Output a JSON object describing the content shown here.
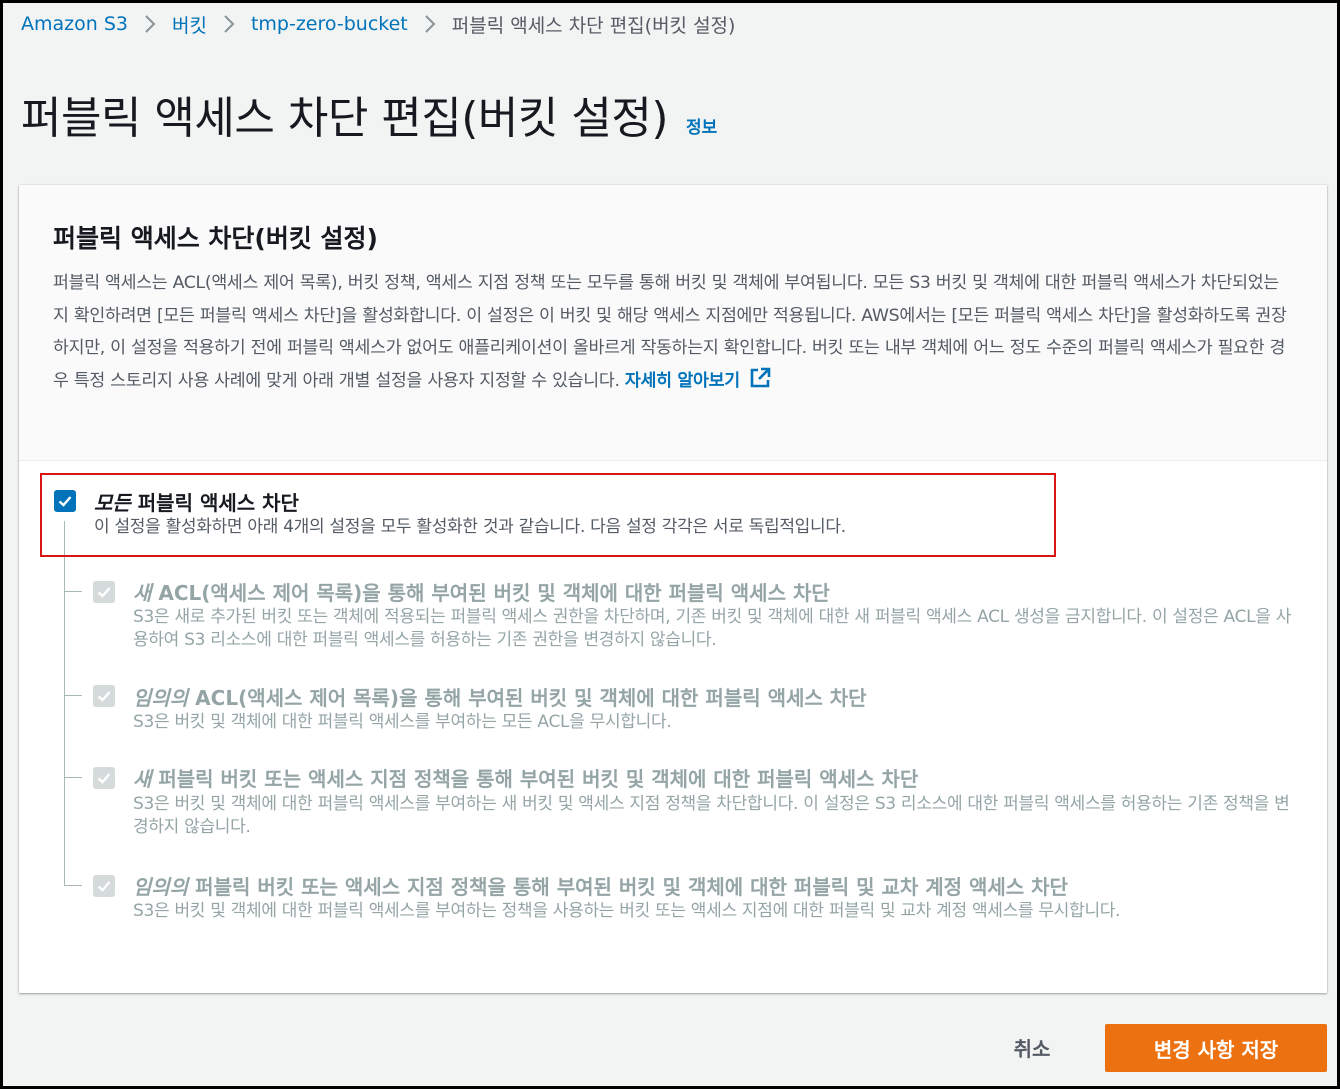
{
  "breadcrumb": {
    "items": [
      "Amazon S3",
      "버킷",
      "tmp-zero-bucket"
    ],
    "current": "퍼블릭 액세스 차단 편집(버킷 설정)"
  },
  "page": {
    "title": "퍼블릭 액세스 차단 편집(버킷 설정)",
    "info_link": "정보"
  },
  "panel": {
    "title": "퍼블릭 액세스 차단(버킷 설정)",
    "description": "퍼블릭 액세스는 ACL(액세스 제어 목록), 버킷 정책, 액세스 지점 정책 또는 모두를 통해 버킷 및 객체에 부여됩니다. 모든 S3 버킷 및 객체에 대한 퍼블릭 액세스가 차단되었는지 확인하려면 [모든 퍼블릭 액세스 차단]을 활성화합니다. 이 설정은 이 버킷 및 해당 액세스 지점에만 적용됩니다. AWS에서는 [모든 퍼블릭 액세스 차단]을 활성화하도록 권장하지만, 이 설정을 적용하기 전에 퍼블릭 액세스가 없어도 애플리케이션이 올바르게 작동하는지 확인합니다. 버킷 또는 내부 객체에 어느 정도 수준의 퍼블릭 액세스가 필요한 경우 특정 스토리지 사용 사례에 맞게 아래 개별 설정을 사용자 지정할 수 있습니다.",
    "learn_more": "자세히 알아보기"
  },
  "main_option": {
    "checked": true,
    "title_em": "모든",
    "title_rest": " 퍼블릭 액세스 차단",
    "description": "이 설정을 활성화하면 아래 4개의 설정을 모두 활성화한 것과 같습니다. 다음 설정 각각은 서로 독립적입니다."
  },
  "sub_options": [
    {
      "checked": true,
      "title_em": "새",
      "title_rest": " ACL(액세스 제어 목록)을 통해 부여된 버킷 및 객체에 대한 퍼블릭 액세스 차단",
      "description": "S3은 새로 추가된 버킷 또는 객체에 적용되는 퍼블릭 액세스 권한을 차단하며, 기존 버킷 및 객체에 대한 새 퍼블릭 액세스 ACL 생성을 금지합니다. 이 설정은 ACL을 사용하여 S3 리소스에 대한 퍼블릭 액세스를 허용하는 기존 권한을 변경하지 않습니다."
    },
    {
      "checked": true,
      "title_em": "임의의",
      "title_rest": " ACL(액세스 제어 목록)을 통해 부여된 버킷 및 객체에 대한 퍼블릭 액세스 차단",
      "description": "S3은 버킷 및 객체에 대한 퍼블릭 액세스를 부여하는 모든 ACL을 무시합니다."
    },
    {
      "checked": true,
      "title_em": "새",
      "title_rest": " 퍼블릭 버킷 또는 액세스 지점 정책을 통해 부여된 버킷 및 객체에 대한 퍼블릭 액세스 차단",
      "description": "S3은 버킷 및 객체에 대한 퍼블릭 액세스를 부여하는 새 버킷 및 액세스 지점 정책을 차단합니다. 이 설정은 S3 리소스에 대한 퍼블릭 액세스를 허용하는 기존 정책을 변경하지 않습니다."
    },
    {
      "checked": true,
      "title_em": "임의의",
      "title_rest": " 퍼블릭 버킷 또는 액세스 지점 정책을 통해 부여된 버킷 및 객체에 대한 퍼블릭 및 교차 계정 액세스 차단",
      "description": "S3은 버킷 및 객체에 대한 퍼블릭 액세스를 부여하는 정책을 사용하는 버킷 또는 액세스 지점에 대한 퍼블릭 및 교차 계정 액세스를 무시합니다."
    }
  ],
  "footer": {
    "cancel_label": "취소",
    "save_label": "변경 사항 저장"
  },
  "colors": {
    "link": "#0073bb",
    "primary_button": "#ec7211",
    "highlight_border": "#d91515",
    "disabled_text": "#95a5a6"
  },
  "icons": {
    "breadcrumb_separator": "chevron-right-icon",
    "external_link": "external-link-icon",
    "checkbox": "checkmark-icon"
  }
}
